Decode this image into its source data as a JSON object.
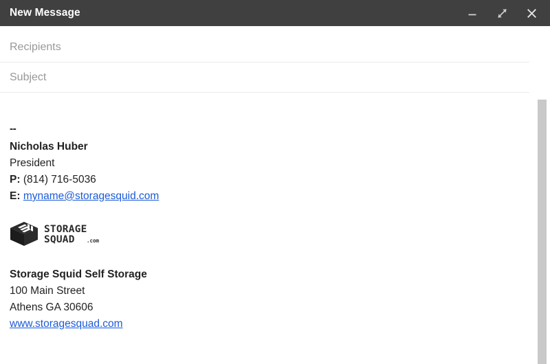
{
  "window": {
    "title": "New Message",
    "controls": [
      {
        "name": "minimize",
        "label": "Minimize",
        "icon": "minimize-icon"
      },
      {
        "name": "expand",
        "label": "Full screen",
        "icon": "expand-icon"
      },
      {
        "name": "close",
        "label": "Save & close",
        "icon": "close-icon"
      }
    ]
  },
  "fields": {
    "recipients": {
      "placeholder": "Recipients",
      "value": ""
    },
    "subject": {
      "placeholder": "Subject",
      "value": ""
    }
  },
  "body": {
    "signature_separator": "--",
    "name": "Nicholas Huber",
    "title": "President",
    "phone_label": "P:",
    "phone_value": "(814) 716-5036",
    "email_label": "E:",
    "email_value": "myname@storagesquid.com",
    "logo": {
      "line1": "STORAGE",
      "line2": "SQUAD",
      "suffix": ".com",
      "alt": "Storage Squad logo"
    },
    "company": "Storage Squid Self Storage",
    "street": "100 Main Street",
    "city_state_zip": "Athens GA 30606",
    "website": "www.storagesquad.com"
  },
  "colors": {
    "titlebar_bg": "#404040",
    "titlebar_text": "#ffffff",
    "placeholder": "#989898",
    "body_text": "#222222",
    "link": "#1a5ad7",
    "divider": "#ececec",
    "scrollbar_thumb": "#c9c9c9",
    "logo_dark": "#2b2b2b"
  }
}
